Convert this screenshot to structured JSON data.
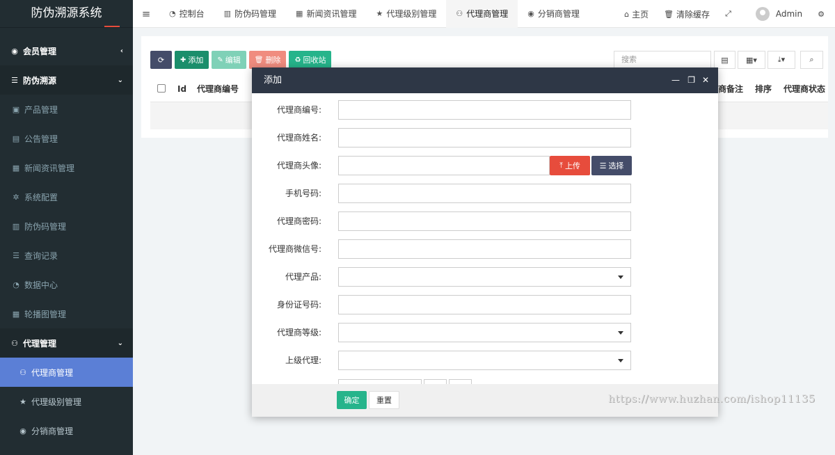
{
  "app": {
    "title": "防伪溯源系统"
  },
  "sidebar": {
    "items": [
      {
        "label": "会员管理",
        "icon": "user-circle-icon",
        "type": "top",
        "caret": "‹"
      },
      {
        "label": "防伪溯源",
        "icon": "list-icon",
        "type": "top",
        "caret": "⌄"
      },
      {
        "label": "产品管理",
        "icon": "briefcase-icon",
        "type": "sub"
      },
      {
        "label": "公告管理",
        "icon": "file-icon",
        "type": "sub"
      },
      {
        "label": "新闻资讯管理",
        "icon": "newspaper-icon",
        "type": "sub"
      },
      {
        "label": "系统配置",
        "icon": "gear-icon",
        "type": "sub"
      },
      {
        "label": "防伪码管理",
        "icon": "barcode-icon",
        "type": "sub"
      },
      {
        "label": "查询记录",
        "icon": "list-icon",
        "type": "sub"
      },
      {
        "label": "数据中心",
        "icon": "dashboard-icon",
        "type": "sub"
      },
      {
        "label": "轮播图管理",
        "icon": "newspaper-icon",
        "type": "sub"
      },
      {
        "label": "代理管理",
        "icon": "users-icon",
        "type": "top",
        "caret": "⌄"
      },
      {
        "label": "代理商管理",
        "icon": "users-icon",
        "type": "sub2-active"
      },
      {
        "label": "代理级别管理",
        "icon": "star-icon",
        "type": "sub2"
      },
      {
        "label": "分销商管理",
        "icon": "user-circle-icon",
        "type": "sub2"
      }
    ]
  },
  "topnav": {
    "tabs": [
      {
        "label": "控制台",
        "icon": "dashboard-icon"
      },
      {
        "label": "防伪码管理",
        "icon": "barcode-icon"
      },
      {
        "label": "新闻资讯管理",
        "icon": "newspaper-icon"
      },
      {
        "label": "代理级别管理",
        "icon": "star-icon"
      },
      {
        "label": "代理商管理",
        "icon": "users-icon"
      },
      {
        "label": "分销商管理",
        "icon": "user-circle-icon"
      }
    ],
    "home": "主页",
    "clear_cache": "清除缓存",
    "user": "Admin"
  },
  "toolbar": {
    "add": "添加",
    "edit": "编辑",
    "delete": "删除",
    "recycle": "回收站",
    "search_placeholder": "搜索"
  },
  "table": {
    "headers": [
      "Id",
      "代理商编号",
      "商备注",
      "排序",
      "代理商状态"
    ]
  },
  "modal": {
    "title": "添加",
    "fields": [
      {
        "label": "代理商编号:",
        "kind": "text"
      },
      {
        "label": "代理商姓名:",
        "kind": "text"
      },
      {
        "label": "代理商头像:",
        "kind": "upload"
      },
      {
        "label": "手机号码:",
        "kind": "text"
      },
      {
        "label": "代理商密码:",
        "kind": "text"
      },
      {
        "label": "代理商微信号:",
        "kind": "text"
      },
      {
        "label": "代理产品:",
        "kind": "select"
      },
      {
        "label": "身份证号码:",
        "kind": "text"
      },
      {
        "label": "代理商等级:",
        "kind": "select"
      },
      {
        "label": "上级代理:",
        "kind": "select"
      }
    ],
    "upload_label": "上传",
    "choose_label": "选择",
    "confirm": "确定",
    "reset": "重置"
  },
  "watermark": "https://www.huzhan.com/ishop11135"
}
